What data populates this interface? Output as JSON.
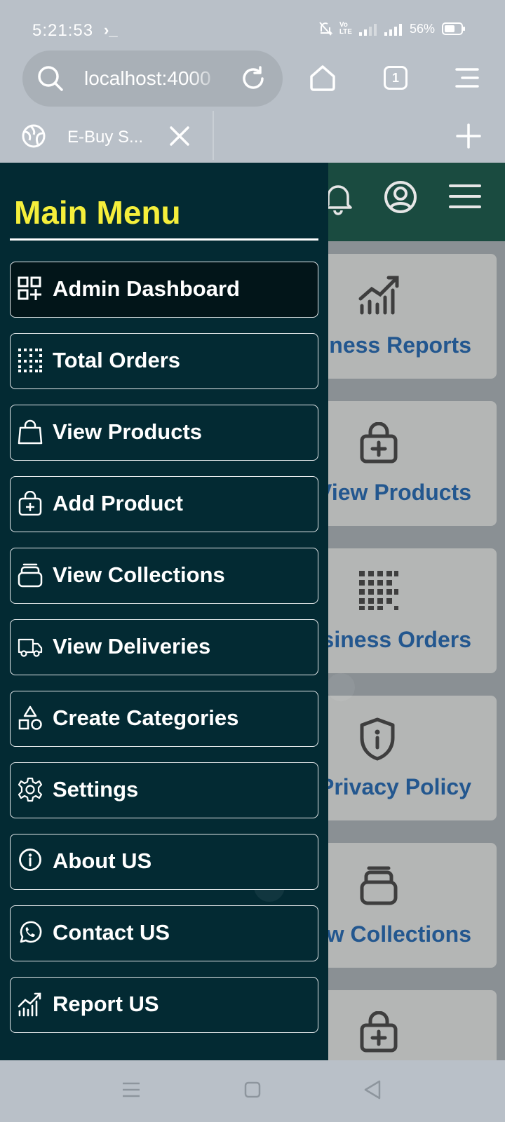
{
  "status_bar": {
    "time": "5:21:53",
    "terminal_glyph": "›_",
    "volte_top": "Vo",
    "volte_bottom": "LTE",
    "battery": "56%"
  },
  "browser": {
    "url": "localhost:4000",
    "tab_count": "1",
    "tab_title": "E-Buy S..."
  },
  "drawer": {
    "title": "Main Menu",
    "items": [
      {
        "label": "Admin Dashboard",
        "icon": "dashboard-grid-icon",
        "active": true
      },
      {
        "label": "Total Orders",
        "icon": "dot-grid-icon"
      },
      {
        "label": "View Products",
        "icon": "shopping-bag-icon"
      },
      {
        "label": "Add Product",
        "icon": "bag-plus-icon"
      },
      {
        "label": "View Collections",
        "icon": "collections-stack-icon"
      },
      {
        "label": "View Deliveries",
        "icon": "truck-icon"
      },
      {
        "label": "Create Categories",
        "icon": "shapes-icon"
      },
      {
        "label": "Settings",
        "icon": "gear-icon"
      },
      {
        "label": "About US",
        "icon": "info-icon"
      },
      {
        "label": "Contact US",
        "icon": "whatsapp-icon"
      },
      {
        "label": "Report US",
        "icon": "chart-trend-icon"
      }
    ]
  },
  "background_cards": [
    {
      "label": "Business Reports",
      "icon": "chart-trend-icon"
    },
    {
      "label": "View Products",
      "icon": "bag-plus-icon"
    },
    {
      "label": "Business Orders",
      "icon": "dot-grid-icon"
    },
    {
      "label": "Privacy Policy",
      "icon": "shield-info-icon"
    },
    {
      "label": "View Collections",
      "icon": "collections-stack-icon"
    },
    {
      "label": "",
      "icon": "bag-plus-icon"
    }
  ],
  "colors": {
    "drawer_bg": "#032a33",
    "drawer_title": "#f5ef3b",
    "header_bg": "#1a4b40",
    "card_label": "#23578f"
  }
}
